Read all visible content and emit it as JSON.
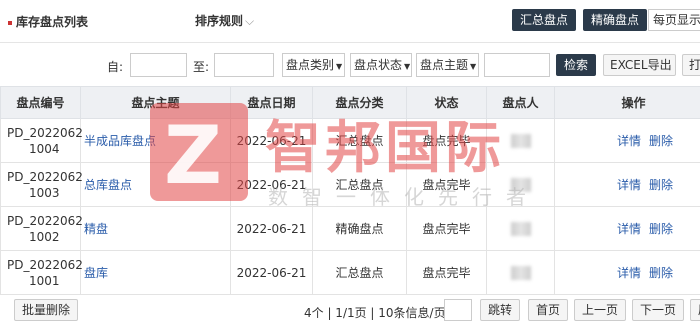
{
  "header": {
    "title": "库存盘点列表",
    "sort_label": "排序规则",
    "btn_summary": "汇总盘点",
    "btn_precise": "精确盘点",
    "per_page": "每页显示"
  },
  "filters": {
    "from_label": "自:",
    "to_label": "至:",
    "category": "盘点类别",
    "status": "盘点状态",
    "theme": "盘点主题",
    "search_btn": "检索",
    "export_btn": "EXCEL导出",
    "print_btn": "打"
  },
  "table": {
    "headers": [
      "盘点编号",
      "盘点主题",
      "盘点日期",
      "盘点分类",
      "状态",
      "盘点人",
      "操作"
    ],
    "rows": [
      {
        "code_l1": "PD_2022062",
        "code_l2": "1004",
        "theme": "半成品库盘点",
        "date": "2022-06-21",
        "category": "汇总盘点",
        "status": "盘点完毕",
        "detail": "详情",
        "delete": "删除"
      },
      {
        "code_l1": "PD_2022062",
        "code_l2": "1003",
        "theme": "总库盘点",
        "date": "2022-06-21",
        "category": "汇总盘点",
        "status": "盘点完毕",
        "detail": "详情",
        "delete": "删除"
      },
      {
        "code_l1": "PD_2022062",
        "code_l2": "1002",
        "theme": "精盘",
        "date": "2022-06-21",
        "category": "精确盘点",
        "status": "盘点完毕",
        "detail": "详情",
        "delete": "删除"
      },
      {
        "code_l1": "PD_2022062",
        "code_l2": "1001",
        "theme": "盘库",
        "date": "2022-06-21",
        "category": "汇总盘点",
        "status": "盘点完毕",
        "detail": "详情",
        "delete": "删除"
      }
    ]
  },
  "footer": {
    "batch_delete": "批量删除",
    "page_info": "4个 | 1/1页 | 10条信息/页",
    "jump": "跳转",
    "first": "首页",
    "prev": "上一页",
    "next": "下一页",
    "last": "尾"
  },
  "watermark": {
    "logo_letter": "Z",
    "title": "智邦国际",
    "subtitle": "数智一体化先行者"
  }
}
